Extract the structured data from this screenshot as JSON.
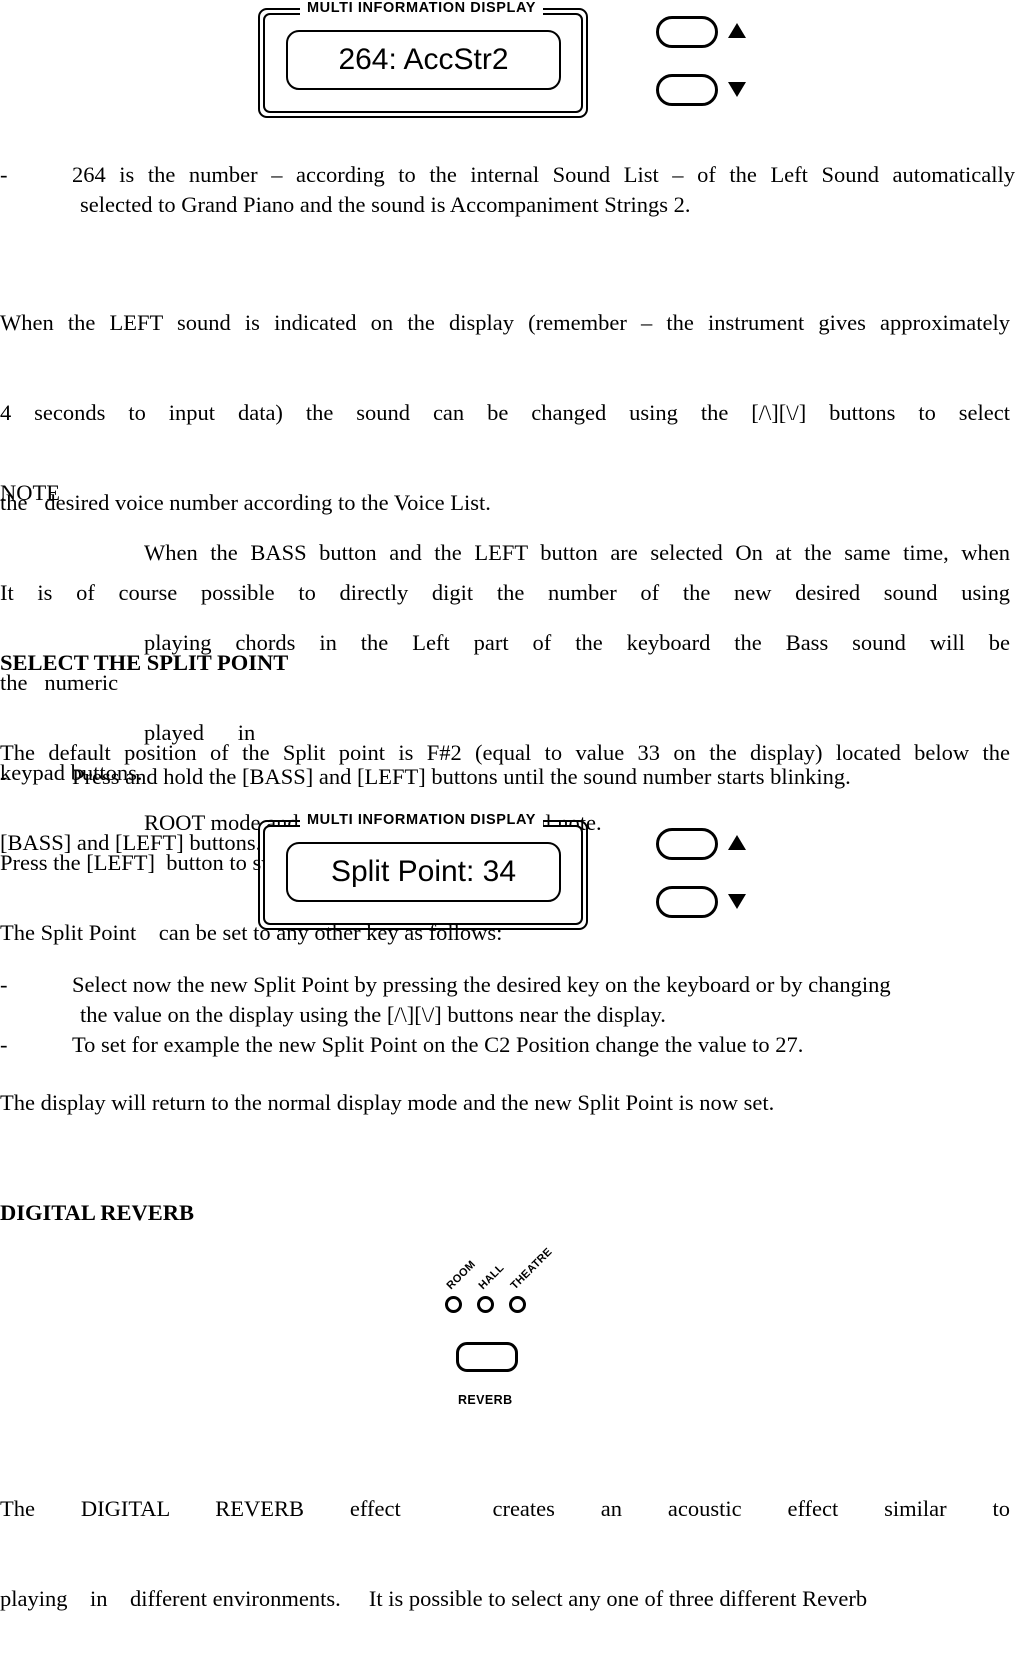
{
  "document": {
    "type": "manual-page",
    "sections": [
      {
        "id": "left-sound",
        "bullet": "-",
        "line1": "264 is the number – according to the internal Sound List – of the Left Sound automatically",
        "line2": "selected to Grand Piano and the sound is Accompaniment Strings 2."
      }
    ]
  },
  "display1": {
    "title": "MULTI INFORMATION DISPLAY",
    "lcd_value": "264: AccStr2",
    "button_up": "",
    "button_down": "",
    "arrow_up_icon": "triangle-up-icon",
    "arrow_down_icon": "triangle-down-icon"
  },
  "display2": {
    "title": "MULTI INFORMATION DISPLAY",
    "lcd_value": "Split Point: 34",
    "button_up": "",
    "button_down": "",
    "arrow_up_icon": "triangle-up-icon",
    "arrow_down_icon": "triangle-down-icon"
  },
  "bullet1": {
    "dash": "-",
    "line1": "264 is the number – according to the internal Sound List – of the Left Sound automatically",
    "line2": "selected to Grand Piano and the sound is Accompaniment Strings 2."
  },
  "paragraph1": {
    "line1": "When the LEFT sound is indicated on the display (remember – the instrument gives approximately",
    "line2": "4 seconds to input data) the sound can be changed using the [/\\][\\/] buttons to select",
    "line3": "the   desired voice number according to the Voice List.",
    "line4": "It is of course possible to directly digit the number of the new desired sound using",
    "line5": "the   numeric",
    "line6": "keypad buttons.",
    "line7": "Press the [LEFT]  button to switch this section ON or OFF."
  },
  "note": {
    "label": "NOTE",
    "line1": "When the BASS button and the LEFT button are selected On at the same time, when",
    "line2": "playing chords in the Left part of the keyboard the Bass sound will be",
    "line3": "played      in",
    "line4": "ROOT mode and will    play the fundamental note."
  },
  "split_section": {
    "heading": "SELECT THE SPLIT POINT",
    "line1": "The default position of the Split point is F#2 (equal to value 33 on the display) located below the",
    "line2": "[BASS] and [LEFT] buttons.",
    "line3": "The Split Point    can be set to any other key as follows:",
    "bullet_dash": "-",
    "bullet_text": "Press and hold the [BASS] and [LEFT] buttons until the sound    number starts blinking."
  },
  "split_after": {
    "bullet1_dash": "-",
    "bullet1_line1": "Select now the new Split Point by pressing the desired key on the keyboard or by changing",
    "bullet1_line2": "the value on the display using the [/\\][\\/] buttons near the display.",
    "bullet2_dash": "-",
    "bullet2_line1": "To set for example the new Split Point on the C2 Position change the value to 27.",
    "closing": "The display will return to the normal display mode and the new Split Point is now set."
  },
  "reverb_section": {
    "heading": "DIGITAL REVERB",
    "led_labels": [
      "ROOM",
      "HALL",
      "THEATRE"
    ],
    "button_caption": "REVERB",
    "button_label": "",
    "text_line1": "The DIGITAL REVERB effect  creates an acoustic effect similar to",
    "text_line2": "playing    in    different environments.     It is possible to select any one of three different Reverb"
  },
  "colors": {
    "ink": "#000000",
    "paper": "#ffffff"
  }
}
